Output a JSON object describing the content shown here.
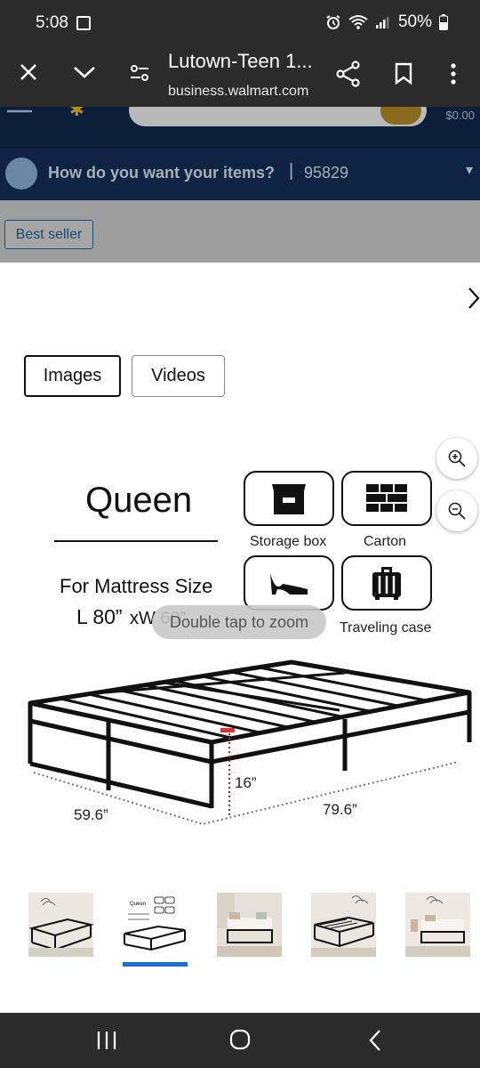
{
  "status_bar": {
    "time": "5:08",
    "battery": "50%"
  },
  "browser": {
    "title": "Lutown-Teen 1...",
    "url": "business.walmart.com"
  },
  "page": {
    "cart_total": "$0.00",
    "delivery_question": "How do you want your items?",
    "zip": "95829",
    "badge": "Best seller"
  },
  "media": {
    "tabs": [
      {
        "label": "Images",
        "active": true
      },
      {
        "label": "Videos",
        "active": false
      }
    ],
    "zoom_hint": "Double tap to zoom",
    "product_image": {
      "size_title": "Queen",
      "mattress_line1": "For Mattress Size",
      "mattress_line2_a": "L 80”",
      "mattress_line2_b": "xW 60”",
      "icons": [
        {
          "label": "Storage box",
          "icon": "storage-box-icon"
        },
        {
          "label": "Carton",
          "icon": "carton-icon"
        },
        {
          "label": "",
          "icon": "high-heel-icon"
        },
        {
          "label": "Traveling case",
          "icon": "suitcase-icon"
        }
      ],
      "dim_height": "16”",
      "dim_width": "59.6”",
      "dim_length": "79.6”"
    },
    "thumbnails": [
      {
        "name": "thumb-1",
        "selected": false
      },
      {
        "name": "thumb-2",
        "selected": true,
        "caption": "Queen"
      },
      {
        "name": "thumb-3",
        "selected": false
      },
      {
        "name": "thumb-4",
        "selected": false
      },
      {
        "name": "thumb-5",
        "selected": false
      }
    ]
  },
  "colors": {
    "accent": "#1a6ed8",
    "walmart_navy": "#0b1f3a",
    "spark": "#b68d24"
  }
}
